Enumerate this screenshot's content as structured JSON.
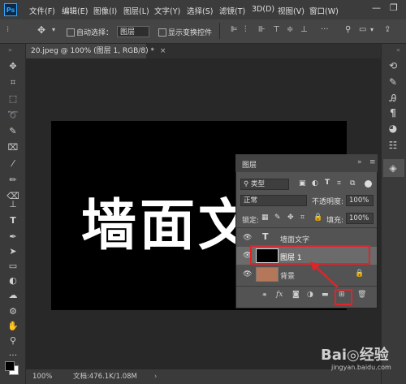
{
  "app": {
    "logo": "Ps"
  },
  "menu": [
    "文件(F)",
    "编辑(E)",
    "图像(I)",
    "图层(L)",
    "文字(Y)",
    "选择(S)",
    "滤镜(T)",
    "3D(D)",
    "视图(V)",
    "窗口(W)"
  ],
  "window_controls": {
    "minimize": "—",
    "restore": "❐"
  },
  "options_bar": {
    "auto_select_label": "自动选择：",
    "auto_select_value": "图层",
    "show_transform_label": "显示变换控件"
  },
  "document_tab": {
    "title": "20.jpeg @ 100% (图层 1, RGB/8) *",
    "close": "×"
  },
  "canvas": {
    "text": "墙面文"
  },
  "status_bar": {
    "zoom": "100%",
    "doc_info": "文档:476.1K/1.08M"
  },
  "layers_panel": {
    "title": "图层",
    "filter_kind": "类型",
    "blend_mode": "正常",
    "opacity_label": "不透明度:",
    "opacity_value": "100%",
    "lock_label": "锁定:",
    "fill_label": "填充:",
    "fill_value": "100%",
    "layers": [
      {
        "name": "墙面文字",
        "type": "text",
        "thumb_color": "#535353"
      },
      {
        "name": "图层 1",
        "type": "pixel",
        "thumb_color": "#000000",
        "selected": true
      },
      {
        "name": "背景",
        "type": "background",
        "thumb_color": "#b5775a",
        "locked": true
      }
    ]
  },
  "watermark": {
    "text": "Bai◎经验",
    "url": "jingyan.baidu.com"
  },
  "colors": {
    "highlight": "#e0242a",
    "selected_row": "#6b6b6b"
  }
}
